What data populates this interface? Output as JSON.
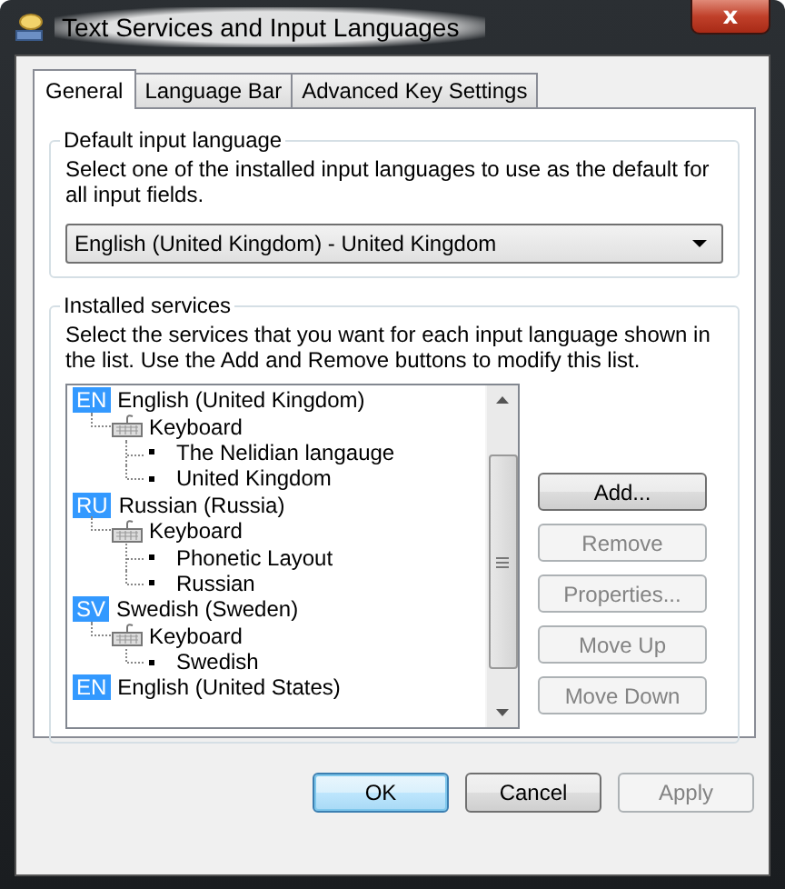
{
  "window": {
    "title": "Text Services and Input Languages",
    "close": "x"
  },
  "tabs": [
    {
      "label": "General",
      "selected": true
    },
    {
      "label": "Language Bar",
      "selected": false
    },
    {
      "label": "Advanced Key Settings",
      "selected": false
    }
  ],
  "default_input_language": {
    "title": "Default input language",
    "description": "Select one of the installed input languages to use as the default for all input fields.",
    "value": "English (United Kingdom) - United Kingdom"
  },
  "installed_services": {
    "title": "Installed services",
    "description": "Select the services that you want for each input language shown in the list. Use the Add and Remove buttons to modify this list.",
    "tree": [
      {
        "code": "EN",
        "label": "English (United Kingdom)",
        "children": [
          {
            "label": "Keyboard",
            "children": [
              {
                "label": "The Nelidian langauge"
              },
              {
                "label": "United Kingdom"
              }
            ]
          }
        ]
      },
      {
        "code": "RU",
        "label": "Russian (Russia)",
        "children": [
          {
            "label": "Keyboard",
            "children": [
              {
                "label": "Phonetic Layout"
              },
              {
                "label": "Russian"
              }
            ]
          }
        ]
      },
      {
        "code": "SV",
        "label": "Swedish (Sweden)",
        "children": [
          {
            "label": "Keyboard",
            "children": [
              {
                "label": "Swedish"
              }
            ]
          }
        ]
      },
      {
        "code": "EN",
        "label": "English (United States)"
      }
    ],
    "buttons": [
      {
        "label": "Add...",
        "disabled": false
      },
      {
        "label": "Remove",
        "disabled": true
      },
      {
        "label": "Properties...",
        "disabled": true
      },
      {
        "label": "Move Up",
        "disabled": true
      },
      {
        "label": "Move Down",
        "disabled": true
      }
    ]
  },
  "dialog_buttons": [
    {
      "label": "OK",
      "disabled": false,
      "default": true
    },
    {
      "label": "Cancel",
      "disabled": false,
      "default": false
    },
    {
      "label": "Apply",
      "disabled": true,
      "default": false
    }
  ]
}
